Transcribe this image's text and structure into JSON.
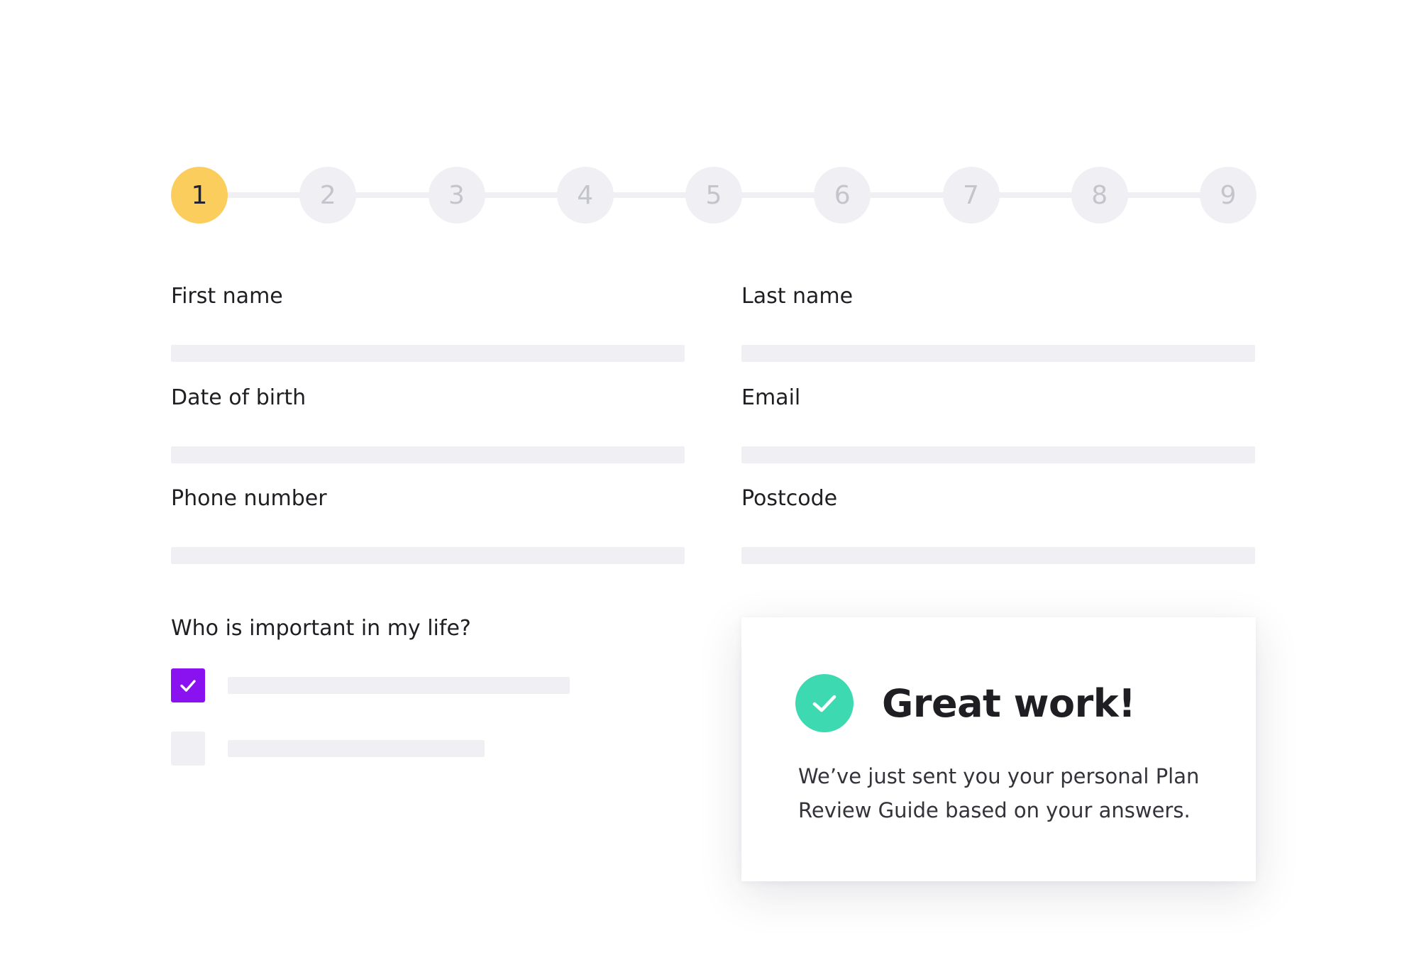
{
  "stepper": {
    "active_step": 1,
    "steps": [
      "1",
      "2",
      "3",
      "4",
      "5",
      "6",
      "7",
      "8",
      "9"
    ]
  },
  "form": {
    "first_name_label": "First name",
    "last_name_label": "Last name",
    "date_of_birth_label": "Date of birth",
    "email_label": "Email",
    "phone_number_label": "Phone number",
    "postcode_label": "Postcode"
  },
  "question": {
    "label": "Who is important in my life?",
    "options": [
      {
        "checked": true
      },
      {
        "checked": false
      }
    ]
  },
  "success_card": {
    "title": "Great work!",
    "message": "We’ve just sent you your personal Plan Review Guide based on your answers."
  },
  "colors": {
    "active_step": "#fbcd5d",
    "checkbox_checked": "#8a12f0",
    "success_icon": "#3dd9b0",
    "placeholder_bar": "#f0f0f4"
  },
  "icons": {
    "checkbox": "checkmark-icon",
    "success": "check-circle-icon"
  }
}
